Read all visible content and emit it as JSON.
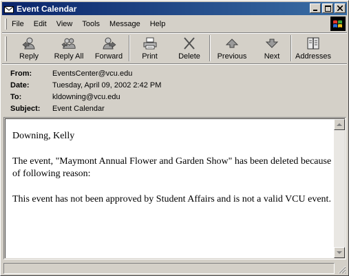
{
  "window": {
    "title": "Event Calendar",
    "title_icon": "envelope-icon"
  },
  "menu": [
    "File",
    "Edit",
    "View",
    "Tools",
    "Message",
    "Help"
  ],
  "toolbar": [
    {
      "label": "Reply",
      "icon": "reply-icon"
    },
    {
      "label": "Reply All",
      "icon": "reply-all-icon"
    },
    {
      "label": "Forward",
      "icon": "forward-icon"
    },
    {
      "label": "Print",
      "icon": "printer-icon"
    },
    {
      "label": "Delete",
      "icon": "delete-icon"
    },
    {
      "label": "Previous",
      "icon": "up-arrow-icon"
    },
    {
      "label": "Next",
      "icon": "down-arrow-icon"
    },
    {
      "label": "Addresses",
      "icon": "address-book-icon"
    }
  ],
  "headers": {
    "from_label": "From:",
    "from": "EventsCenter@vcu.edu",
    "date_label": "Date:",
    "date": "Tuesday, April 09, 2002 2:42 PM",
    "to_label": "To:",
    "to": "kldowning@vcu.edu",
    "subject_label": "Subject:",
    "subject": "Event Calendar"
  },
  "message": {
    "greeting": "Downing, Kelly",
    "para1": "The event, \"Maymont Annual Flower and Garden Show\" has been deleted because of following reason:",
    "para2": "This event has not been approved by Student Affairs and is not a valid VCU event."
  }
}
